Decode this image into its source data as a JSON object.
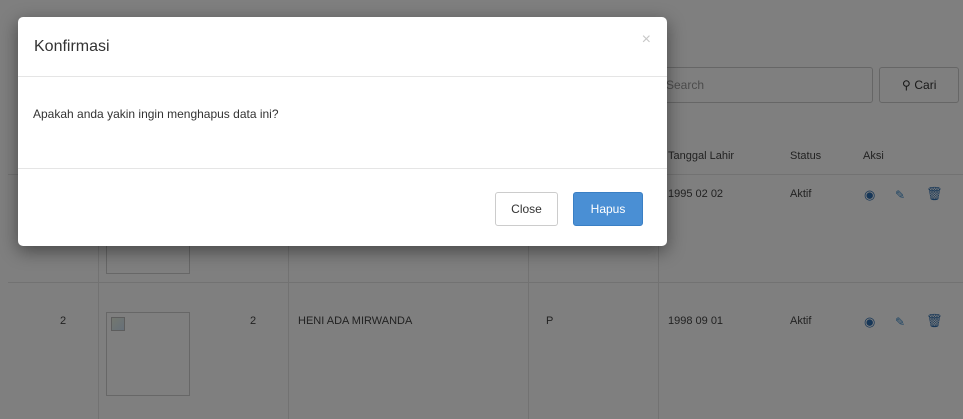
{
  "modal": {
    "title": "Konfirmasi",
    "close_icon": "×",
    "message": "Apakah anda yakin ingin menghapus data ini?",
    "close_label": "Close",
    "delete_label": "Hapus"
  },
  "search": {
    "placeholder": "Search",
    "button_label": "Cari",
    "button_icon": "search-icon"
  },
  "table": {
    "columns": [
      "Tanggal Lahir",
      "Status",
      "Aksi"
    ],
    "rows": [
      {
        "no": "",
        "id": "",
        "nama": "",
        "jk": "",
        "tanggal_lahir": "1995 02 02",
        "status": "Aktif"
      },
      {
        "no": "2",
        "id": "2",
        "nama": "HENI ADA MIRWANDA",
        "jk": "P",
        "tanggal_lahir": "1998 09 01",
        "status": "Aktif"
      }
    ],
    "action_icons": [
      "eye-icon",
      "edit-icon",
      "trash-icon"
    ],
    "action_color": "#2f6fb0"
  },
  "colors": {
    "primary_button": "#4a8fd4",
    "backdrop": "rgba(0,0,0,0.5)"
  }
}
